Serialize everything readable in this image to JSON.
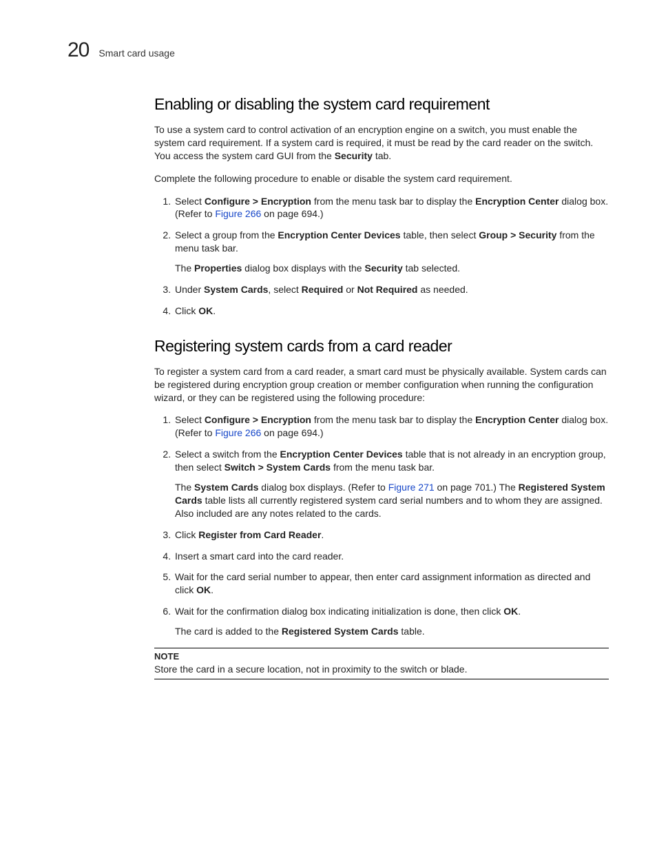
{
  "header": {
    "chapter_number": "20",
    "chapter_title": "Smart card usage"
  },
  "section1": {
    "heading": "Enabling or disabling the system card requirement",
    "intro_parts": {
      "pre": "To use a system card to control activation of an encryption engine on a switch, you must enable the system card requirement. If a system card is required, it must be read by the card reader on the switch. You access the system card GUI from the ",
      "bold_security": "Security",
      "post": " tab."
    },
    "lead": "Complete the following procedure to enable or disable the system card requirement.",
    "step1": {
      "pre": "Select ",
      "bold_menu": "Configure > Encryption",
      "mid": " from the menu task bar to display the ",
      "bold_center": "Encryption Center",
      "post1": " dialog box. (Refer to ",
      "link": "Figure 266",
      "post2": " on page 694.)"
    },
    "step2": {
      "pre": "Select a group from the ",
      "bold_devices": "Encryption Center Devices",
      "mid": " table, then select ",
      "bold_path": "Group > Security",
      "post": " from the menu task bar.",
      "follow_pre": "The ",
      "follow_b1": "Properties",
      "follow_mid": " dialog box displays with the ",
      "follow_b2": "Security",
      "follow_post": " tab selected."
    },
    "step3": {
      "pre": "Under ",
      "b1": "System Cards",
      "mid1": ", select ",
      "b2": "Required",
      "mid2": " or ",
      "b3": "Not Required",
      "post": " as needed."
    },
    "step4": {
      "pre": "Click ",
      "b1": "OK",
      "post": "."
    }
  },
  "section2": {
    "heading": "Registering system cards from a card reader",
    "intro": "To register a system card from a card reader, a smart card must be physically available. System cards can be registered during encryption group creation or member configuration when running the configuration wizard, or they can be registered using the following procedure:",
    "step1": {
      "pre": "Select ",
      "bold_menu": "Configure > Encryption",
      "mid": " from the menu task bar to display the ",
      "bold_center": "Encryption Center",
      "post1": " dialog box. (Refer to ",
      "link": "Figure 266",
      "post2": " on page 694.)"
    },
    "step2": {
      "pre": "Select a switch from the ",
      "bold_devices": "Encryption Center Devices",
      "mid": " table that is not already in an encryption group, then select ",
      "bold_path": "Switch > System Cards",
      "post": " from the menu task bar.",
      "follow_pre": "The ",
      "follow_b1": "System Cards",
      "follow_mid1": " dialog box displays. (Refer to ",
      "follow_link": "Figure 271",
      "follow_mid2": " on page 701.) The ",
      "follow_b2": "Registered System Cards",
      "follow_post": " table lists all currently registered system card serial numbers and to whom they are assigned. Also included are any notes related to the cards."
    },
    "step3": {
      "pre": "Click ",
      "b1": "Register from Card Reader",
      "post": "."
    },
    "step4": "Insert a smart card into the card reader.",
    "step5": {
      "pre": "Wait for the card serial number to appear, then enter card assignment information as directed and click ",
      "b1": "OK",
      "post": "."
    },
    "step6": {
      "pre": "Wait for the confirmation dialog box indicating initialization is done, then click ",
      "b1": "OK",
      "post": ".",
      "follow_pre": "The card is added to the ",
      "follow_b1": "Registered System Cards",
      "follow_post": " table."
    }
  },
  "note": {
    "label": "NOTE",
    "body": "Store the card in a secure location, not in proximity to the switch or blade."
  }
}
